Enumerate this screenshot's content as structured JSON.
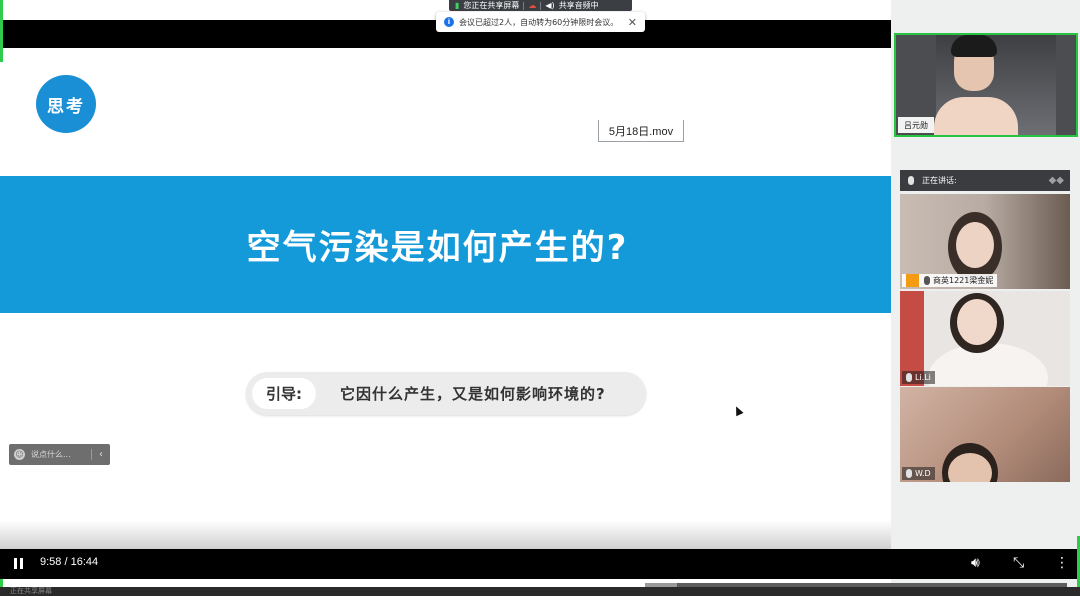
{
  "share_bar": {
    "sharing_label": "您正在共享屏幕",
    "audio_label": "共享音频中"
  },
  "notice": {
    "text": "会议已超过2人，自动转为60分钟限时会议。"
  },
  "slide": {
    "badge": "思考",
    "filename": "5月18日.mov",
    "title": "空气污染是如何产生的?",
    "guide_label": "引导:",
    "guide_text": "它因什么产生，又是如何影响环境的?"
  },
  "comment": {
    "placeholder": "说点什么..."
  },
  "host": {
    "name": "吕元勋"
  },
  "speaking": {
    "label": "正在讲话:"
  },
  "participants": [
    {
      "name": "商英1221梁金妮"
    },
    {
      "name": "Li.Li"
    },
    {
      "name": "W.D"
    }
  ],
  "player": {
    "time": "9:58 / 16:44",
    "progress": 0.6
  },
  "bottom_strip": {
    "text": "正在共享屏幕"
  },
  "colors": {
    "accent_blue": "#159ad9",
    "active_green": "#27c443"
  }
}
